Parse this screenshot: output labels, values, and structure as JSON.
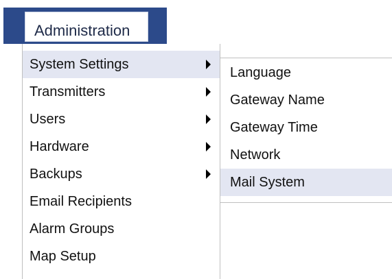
{
  "top_menu": {
    "label": "Administration"
  },
  "dropdown": {
    "items": [
      {
        "label": "System Settings",
        "has_submenu": true,
        "active": true
      },
      {
        "label": "Transmitters",
        "has_submenu": true,
        "active": false
      },
      {
        "label": "Users",
        "has_submenu": true,
        "active": false
      },
      {
        "label": "Hardware",
        "has_submenu": true,
        "active": false
      },
      {
        "label": "Backups",
        "has_submenu": true,
        "active": false
      },
      {
        "label": "Email Recipients",
        "has_submenu": false,
        "active": false
      },
      {
        "label": "Alarm Groups",
        "has_submenu": false,
        "active": false
      },
      {
        "label": "Map Setup",
        "has_submenu": false,
        "active": false
      }
    ]
  },
  "submenu": {
    "items": [
      {
        "label": "Language",
        "active": false
      },
      {
        "label": "Gateway Name",
        "active": false
      },
      {
        "label": "Gateway Time",
        "active": false
      },
      {
        "label": "Network",
        "active": false
      },
      {
        "label": "Mail System",
        "active": true
      }
    ]
  },
  "colors": {
    "top_button_bg": "#2c4a8a",
    "highlight": "#e3e6f2",
    "text": "#111111",
    "border": "#bfbfbf"
  },
  "icons": {
    "submenu_arrow": "chevron-right-icon"
  }
}
